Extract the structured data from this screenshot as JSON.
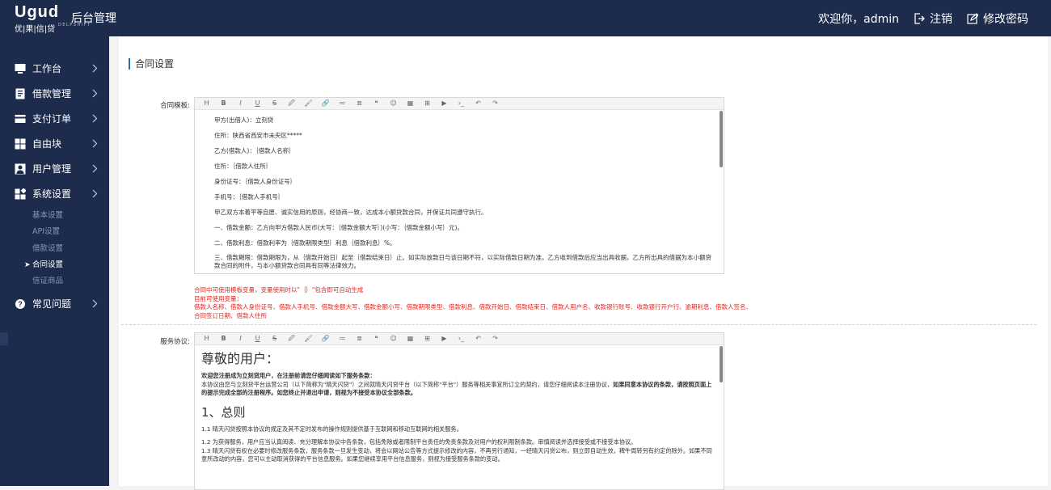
{
  "header": {
    "logo_mark": "Ugud",
    "logo_sub": "优|果|信|贷",
    "logo_sub2": "DELPSHIFT",
    "title": "后台管理",
    "welcome": "欢迎你，admin",
    "logout": "注销",
    "change_password": "修改密码"
  },
  "sidebar": {
    "items": [
      {
        "label": "工作台",
        "icon": "monitor-icon"
      },
      {
        "label": "借款管理",
        "icon": "document-icon"
      },
      {
        "label": "支付订单",
        "icon": "card-icon"
      },
      {
        "label": "自由块",
        "icon": "grid-icon"
      },
      {
        "label": "用户管理",
        "icon": "user-icon"
      },
      {
        "label": "系统设置",
        "icon": "apps-icon"
      }
    ],
    "sub_items": [
      "基本设置",
      "API设置",
      "借款设置",
      "合同设置",
      "信证商品"
    ],
    "active_sub": "合同设置",
    "last_item": {
      "label": "常见问题",
      "icon": "help-icon"
    }
  },
  "page": {
    "title": "合同设置",
    "contract_label": "合同模板:",
    "service_label": "服务协议:"
  },
  "toolbar": [
    "H",
    "B",
    "I",
    "U",
    "S",
    "🖉",
    "🖌",
    "🔗",
    "≔",
    "≣",
    "❝",
    "☺",
    "▦",
    "⊞",
    "▶",
    "›_",
    "↶",
    "↷"
  ],
  "contract": {
    "lines": [
      "甲方(出借人)：立刻贷",
      "住所：陕西省西安市未央区*****",
      "乙方(借款人)：｛借款人名称｝",
      "住所：｛借款人住所｝",
      "身份证号：｛借款人身份证号｝",
      "手机号：｛借款人手机号｝",
      "甲乙双方本着平等自愿、诚实信用的原则，经协商一致，达成本小额贷款合同，并保证共同遵守执行。",
      "一、借款金额：乙方向甲方借款人民币(大写：｛借款金额大写｝)(小写：｛借款金额小写｝元)。",
      "二、借款利息：借款利率为｛借款期限类型｝利息｛借款利息｝%。"
    ],
    "last_para": "三、借款期限：借款期限为，从｛借款开始日｝起至｛借款结束日｝止。如实际放款日与该日期不符，以实际借款日期为准。乙方收到借款后应当出具收据，乙方所出具的借据为本小额贷款合同的附件，与本小额贷款合同具有同等法律效力。"
  },
  "hint": {
    "line1": "合同中可使用模板变量，变量使用时以\"｛｝\"包含即可自动生成",
    "line2": "目前可使用变量：",
    "line3": "借款人名称、借款人身份证号、借款人手机号、借款金额大写、借款金额小写、借款期限类型、借款利息、借款开始日、借款结束日、借款人用户名、收款银行账号、收款银行开户行、逾期利息、借款人签名、",
    "line4": "合同签订日期、借款人住所"
  },
  "service": {
    "heading": "尊敬的用户：",
    "intro_bold": "欢迎您注册成为立刻贷用户，在注册前请您仔细阅读如下服务条款：",
    "intro_text": "本协议由您与立刻贷平台运营公司（以下简称为\"晴天闪贷\"）之间就晴天闪贷平台（以下简称\"平台\"）服务等相关事宜所订立的契约，请您仔细阅读本注册协议，",
    "intro_bold2": "如果同意本协议的条款，请按照页面上的提示完成全部的注册程序。如您终止并退出申请，则视为不接受本协议全部条款。",
    "section1": "1、总则",
    "p11": "1.1 晴天闪贷按照本协议的规定及其不定时发布的操作规则提供基于互联网和移动互联网的相关服务。",
    "p12": "1.2 为获得服务，用户应当认真阅读、充分理解本协议中各条款，包括免除或者限制平台责任的免责条款及对用户的权利限制条款。审慎阅读并选择接受或不接受本协议。",
    "p13": "1.3 晴天闪贷有权在必要时修改服务条款，服务条款一旦发生变动，将会以网站公告等方式提示修改的内容，不再另行通知，一经晴天闪贷公布，则立即自动生效，稗牛周转另有约定的除外。如果不同意所改动的内容，您可以主动取消获得的平台信息服务。如果您继续享用平台信息服务，则视为接受服务条款的变动。"
  }
}
